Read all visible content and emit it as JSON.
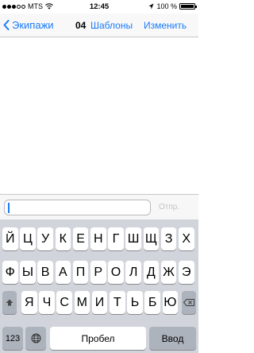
{
  "status_bar": {
    "carrier": "MTS",
    "time": "12:45",
    "battery": "100 %",
    "signal_bars_filled": 3,
    "signal_bars_total": 5
  },
  "nav": {
    "back_label": "Экипажи",
    "count": "04",
    "templates_label": "Шаблоны",
    "edit_label": "Изменить"
  },
  "input": {
    "value": "",
    "send_label": "Отпр."
  },
  "keyboard": {
    "row1": [
      "Й",
      "Ц",
      "У",
      "К",
      "Е",
      "Н",
      "Г",
      "Ш",
      "Щ",
      "З",
      "Х"
    ],
    "row2": [
      "Ф",
      "Ы",
      "В",
      "А",
      "П",
      "Р",
      "О",
      "Л",
      "Д",
      "Ж",
      "Э"
    ],
    "row3": [
      "Я",
      "Ч",
      "С",
      "М",
      "И",
      "Т",
      "Ь",
      "Б",
      "Ю"
    ],
    "numbers_label": "123",
    "space_label": "Пробел",
    "return_label": "Ввод"
  },
  "colors": {
    "accent": "#1a7cfa",
    "keyboard_bg": "#d1d5db",
    "key_dark": "#adb3bc"
  }
}
